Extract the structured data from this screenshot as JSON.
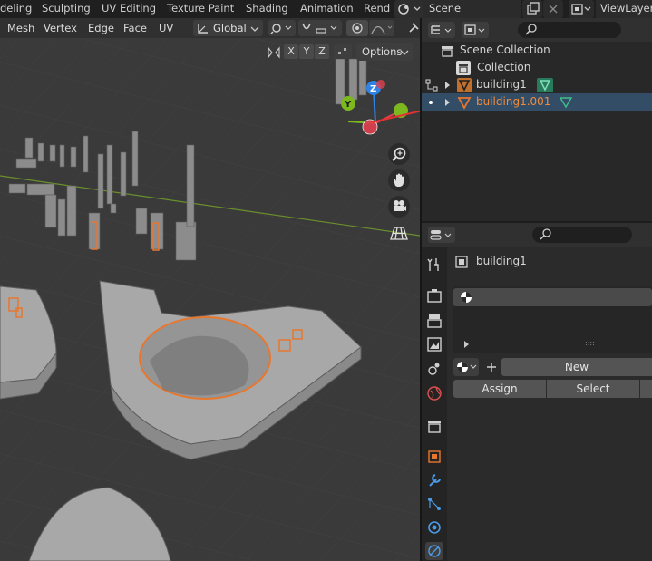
{
  "workspaces": {
    "tabs": [
      {
        "label": "deling",
        "active": false
      },
      {
        "label": "Sculpting",
        "active": false
      },
      {
        "label": "UV Editing",
        "active": false
      },
      {
        "label": "Texture Paint",
        "active": false
      },
      {
        "label": "Shading",
        "active": false
      },
      {
        "label": "Animation",
        "active": false
      },
      {
        "label": "Rend",
        "active": false
      }
    ],
    "scene": "Scene",
    "view_layer": "ViewLayer"
  },
  "viewport": {
    "menus": [
      "Mesh",
      "Vertex",
      "Edge",
      "Face",
      "UV"
    ],
    "orientation": "Global",
    "axes": [
      "X",
      "Y",
      "Z"
    ],
    "options_label": "Options",
    "gizmo_labels": {
      "y": "Y",
      "z": "Z"
    }
  },
  "outliner": {
    "search_placeholder": "",
    "items": [
      {
        "label": "Scene Collection",
        "indent": 0,
        "icon": "scene-collection-icon"
      },
      {
        "label": "Collection",
        "indent": 1,
        "icon": "collection-icon"
      },
      {
        "label": "building1",
        "indent": 2,
        "icon": "mesh-object-icon",
        "selected": false
      },
      {
        "label": "building1.001",
        "indent": 2,
        "icon": "mesh-object-icon",
        "selected": true
      }
    ]
  },
  "properties": {
    "search_placeholder": "",
    "object_name": "building1",
    "list_dots": "::::",
    "new_label": "New",
    "assign_label": "Assign",
    "select_label": "Select"
  },
  "colors": {
    "accent_orange": "#e8772e",
    "selected_row": "#334d66",
    "mesh_data_green": "#3fbf8a",
    "gizmo_x": "#e0404f",
    "gizmo_y": "#7cb81e",
    "gizmo_z": "#2f83e6"
  }
}
